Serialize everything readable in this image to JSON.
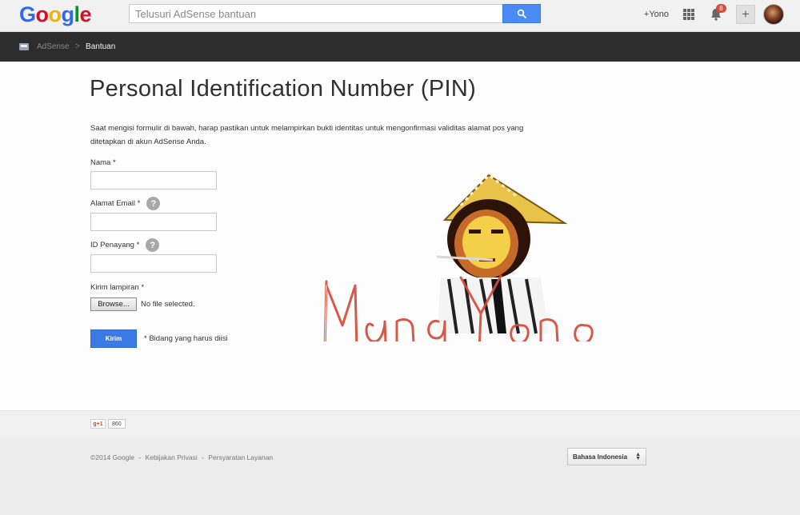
{
  "header": {
    "logo_letters": [
      {
        "ch": "G",
        "color": "#3369e8"
      },
      {
        "ch": "o",
        "color": "#d50f25"
      },
      {
        "ch": "o",
        "color": "#eeb211"
      },
      {
        "ch": "g",
        "color": "#3369e8"
      },
      {
        "ch": "l",
        "color": "#009925"
      },
      {
        "ch": "e",
        "color": "#d50f25"
      }
    ],
    "search_placeholder": "Telusuri AdSense bantuan",
    "search_icon": "search-icon",
    "user_link": "+Yono",
    "notification_count": "8",
    "share_icon": "+"
  },
  "breadcrumb": {
    "product": "AdSense",
    "separator": ">",
    "current": "Bantuan"
  },
  "form": {
    "title": "Personal Identification Number (PIN)",
    "intro": "Saat mengisi formulir di bawah, harap pastikan untuk melampirkan bukti identitas untuk mengonfirmasi validitas alamat pos yang ditetapkan di akun AdSense Anda.",
    "name_label": "Nama *",
    "email_label": "Alamat Email *",
    "publisher_label": "ID Penayang *",
    "help_glyph": "?",
    "attachment_label": "Kirim lampiran *",
    "browse_label": "Browse...",
    "file_status": "No file selected.",
    "submit_label": "Kirim",
    "required_note": "* Bidang yang harus diisi"
  },
  "watermark": {
    "text": "MangYono"
  },
  "social": {
    "plusone_label": "g+1",
    "plusone_count": "860"
  },
  "footer": {
    "copyright": "©2014 Google",
    "sep": "-",
    "privacy": "Kebijakan Privasi",
    "terms": "Persyaratan Layanan",
    "language": "Bahasa Indonesia",
    "language_arrows": "▲▼"
  },
  "colors": {
    "accent_blue": "#4a8af4",
    "submit_blue": "#3b7ae4",
    "dark_bar": "#2d2d2d",
    "notification_red": "#dd4b39"
  }
}
